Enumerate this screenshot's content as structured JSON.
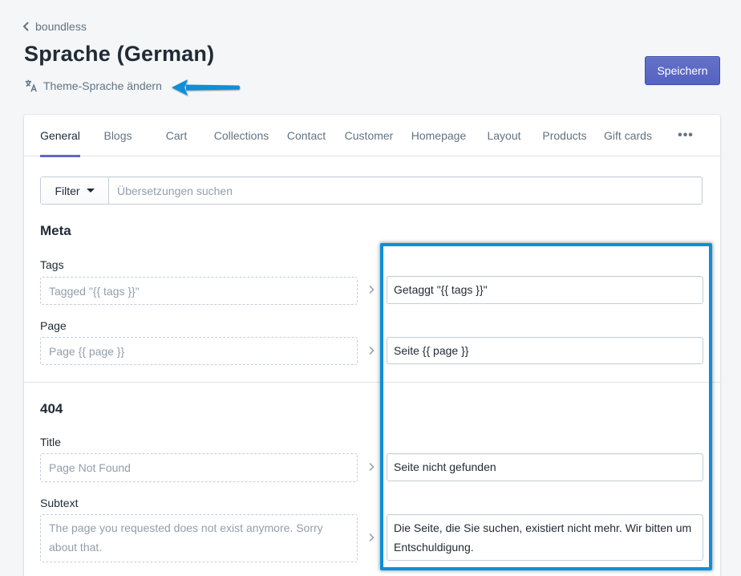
{
  "header": {
    "back_label": "boundless",
    "title": "Sprache (German)",
    "change_language_label": "Theme-Sprache ändern",
    "save_label": "Speichern"
  },
  "tabs": [
    {
      "label": "General",
      "active": true
    },
    {
      "label": "Blogs"
    },
    {
      "label": "Cart"
    },
    {
      "label": "Collections"
    },
    {
      "label": "Contact"
    },
    {
      "label": "Customer"
    },
    {
      "label": "Homepage"
    },
    {
      "label": "Layout"
    },
    {
      "label": "Products"
    },
    {
      "label": "Gift cards"
    },
    {
      "label": "•••"
    }
  ],
  "filter": {
    "button_label": "Filter",
    "search_placeholder": "Übersetzungen suchen"
  },
  "sections": [
    {
      "title": "Meta",
      "fields": [
        {
          "label": "Tags",
          "source": "Tagged \"{{ tags }}\"",
          "translation": "Getaggt \"{{ tags }}\""
        },
        {
          "label": "Page",
          "source": "Page {{ page }}",
          "translation": "Seite {{ page }}"
        }
      ]
    },
    {
      "title": "404",
      "fields": [
        {
          "label": "Title",
          "source": "Page Not Found",
          "translation": "Seite nicht gefunden"
        },
        {
          "label": "Subtext",
          "source": "The page you requested does not exist anymore. Sorry about that.",
          "translation": "Die Seite, die Sie suchen, existiert nicht mehr. Wir bitten um Entschuldigung."
        }
      ]
    }
  ],
  "colors": {
    "accent": "#5c6ac4",
    "annotation": "#0d8fd9"
  }
}
